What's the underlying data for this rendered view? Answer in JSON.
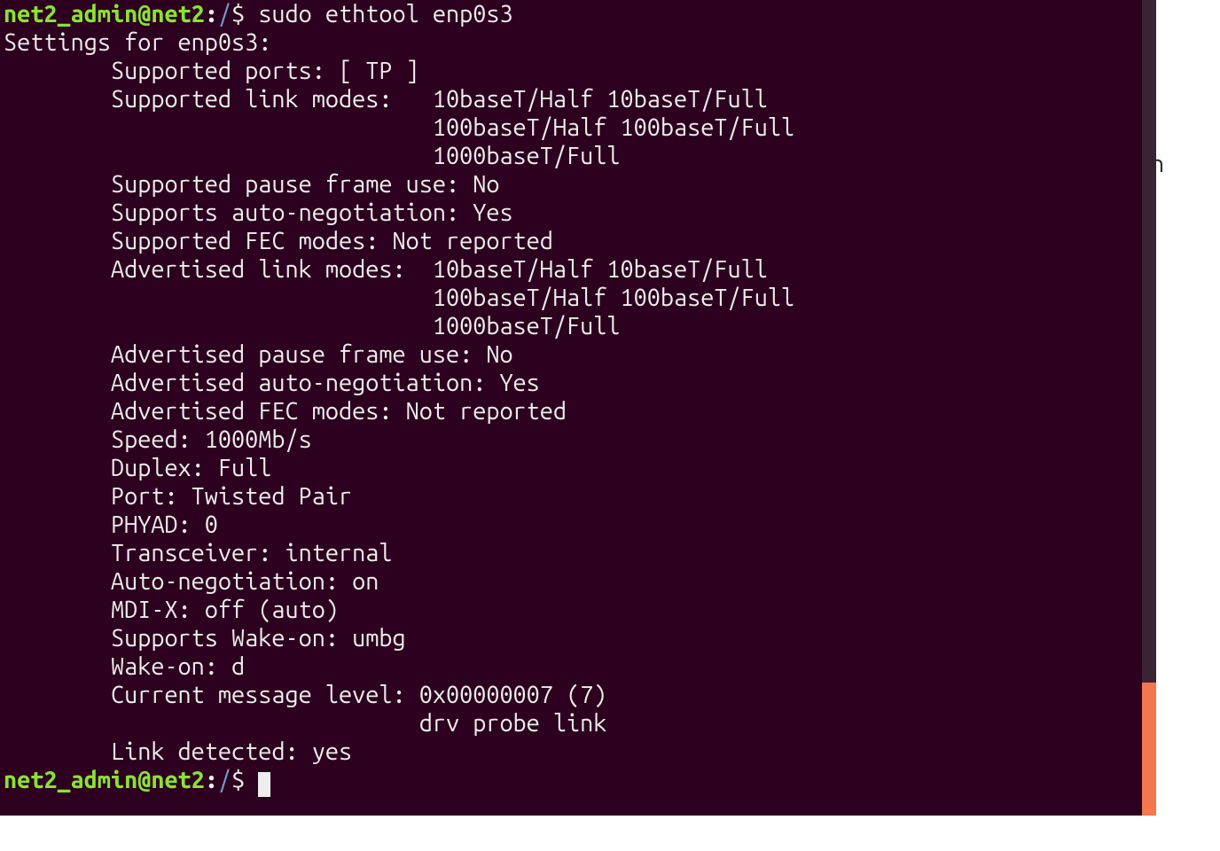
{
  "prompt1": {
    "userhost": "net2_admin@net2",
    "sep": ":",
    "path": "/",
    "dollar": "$ "
  },
  "command": "sudo ethtool enp0s3",
  "prompt2": {
    "userhost": "net2_admin@net2",
    "sep": ":",
    "path": "/",
    "dollar": "$ "
  },
  "output": {
    "l0": "Settings for enp0s3:",
    "l1": "        Supported ports: [ TP ]",
    "l2": "        Supported link modes:   10baseT/Half 10baseT/Full",
    "l3": "                                100baseT/Half 100baseT/Full",
    "l4": "                                1000baseT/Full",
    "l5": "        Supported pause frame use: No",
    "l6": "        Supports auto-negotiation: Yes",
    "l7": "        Supported FEC modes: Not reported",
    "l8": "        Advertised link modes:  10baseT/Half 10baseT/Full",
    "l9": "                                100baseT/Half 100baseT/Full",
    "l10": "                                1000baseT/Full",
    "l11": "        Advertised pause frame use: No",
    "l12": "        Advertised auto-negotiation: Yes",
    "l13": "        Advertised FEC modes: Not reported",
    "l14": "        Speed: 1000Mb/s",
    "l15": "        Duplex: Full",
    "l16": "        Port: Twisted Pair",
    "l17": "        PHYAD: 0",
    "l18": "        Transceiver: internal",
    "l19": "        Auto-negotiation: on",
    "l20": "        MDI-X: off (auto)",
    "l21": "        Supports Wake-on: umbg",
    "l22": "        Wake-on: d",
    "l23": "        Current message level: 0x00000007 (7)",
    "l24": "                               drv probe link",
    "l25": "        Link detected: yes"
  },
  "stray": "n"
}
